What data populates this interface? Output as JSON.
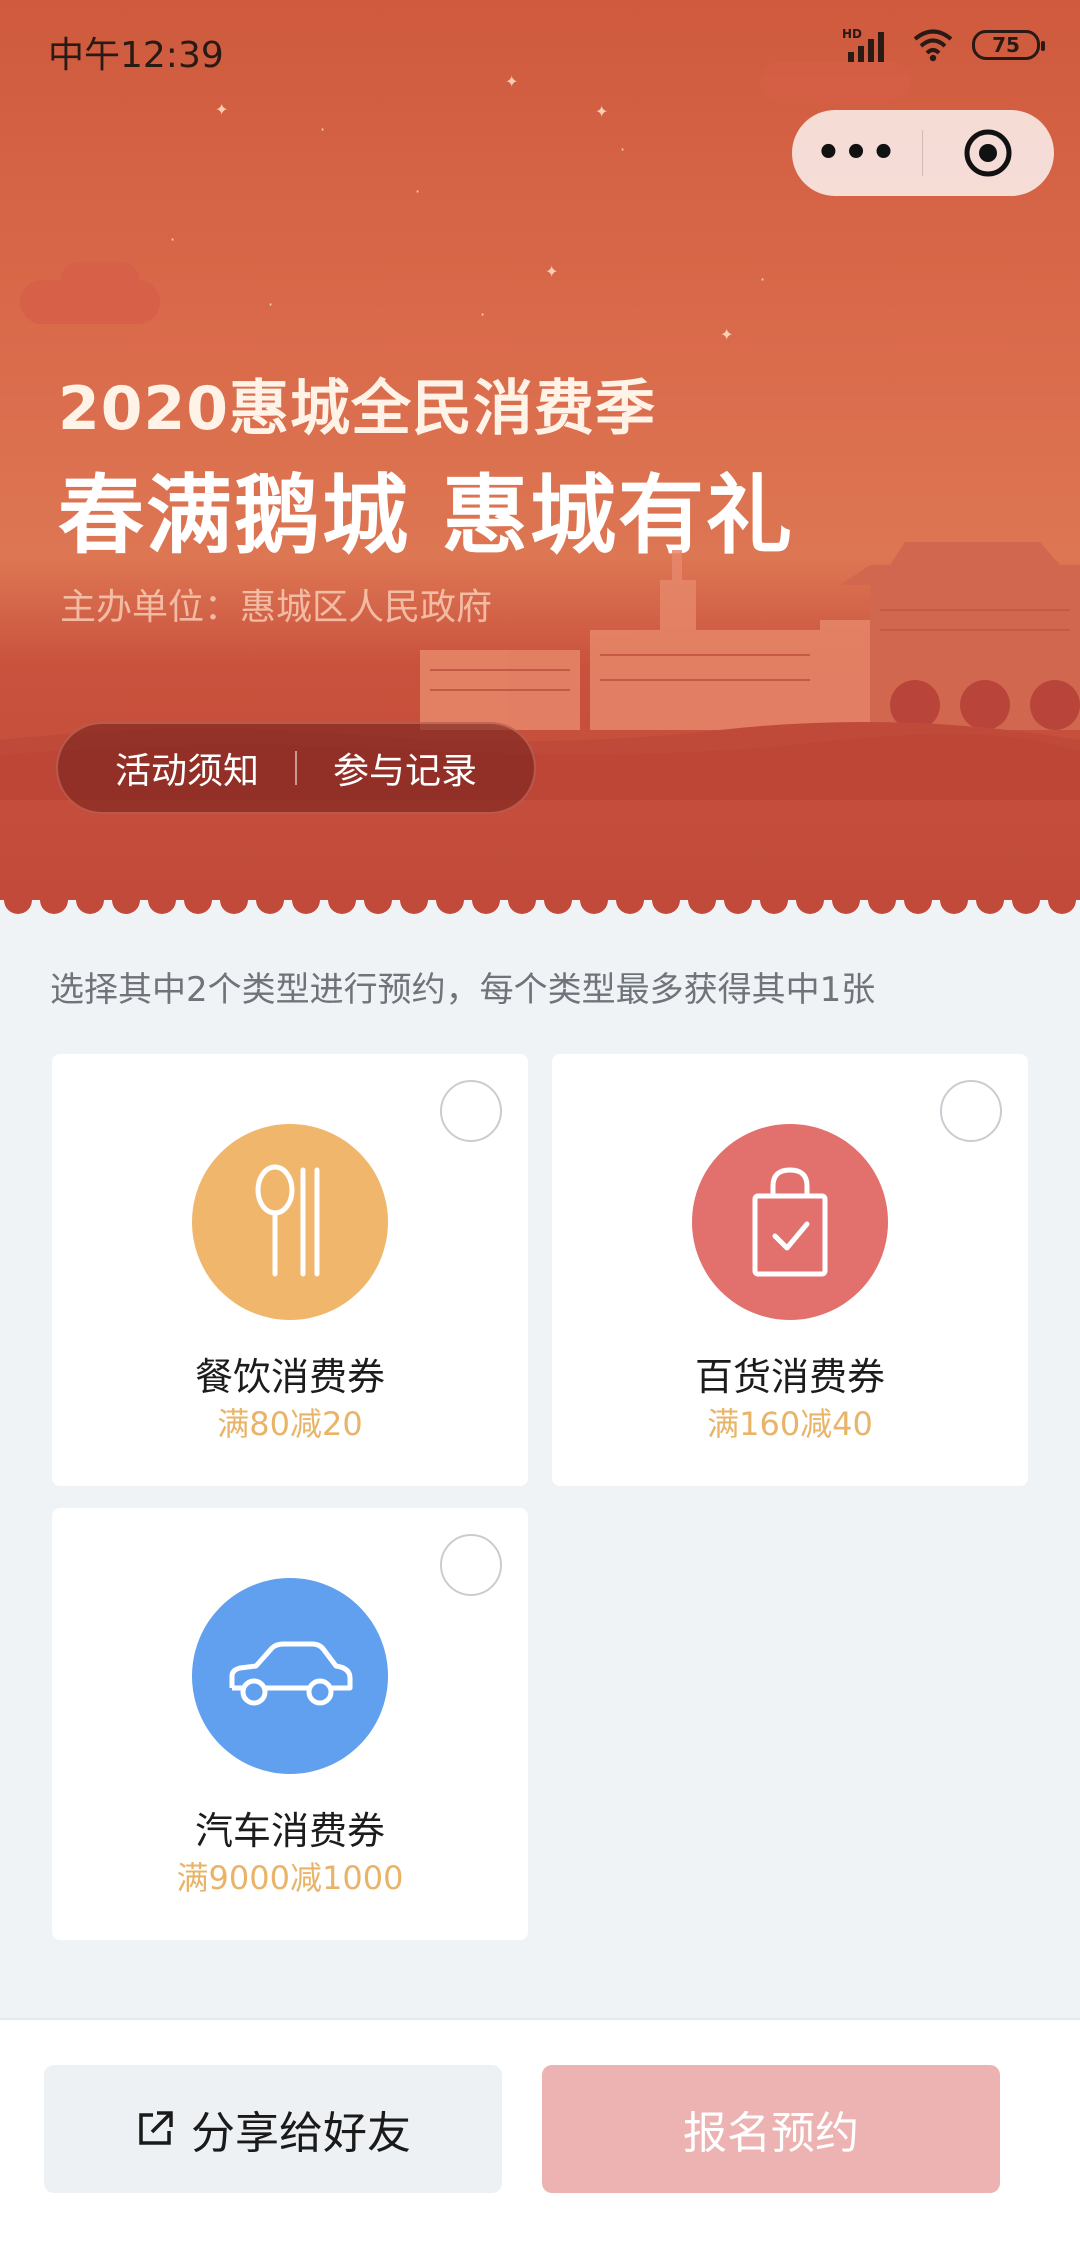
{
  "status_bar": {
    "time": "中午12:39",
    "signal_tag": "HD",
    "battery": "75"
  },
  "capsule": {
    "more_label": "•••"
  },
  "hero": {
    "title_line1": "2020惠城全民消费季",
    "title_line2": "春满鹅城  惠城有礼",
    "organizer": "主办单位：惠城区人民政府",
    "tab_notice": "活动须知",
    "tab_records": "参与记录"
  },
  "main": {
    "hint": "选择其中2个类型进行预约，每个类型最多获得其中1张",
    "coupons": [
      {
        "name": "餐饮消费券",
        "rule": "满80减20",
        "icon": "spoon-chopsticks-icon",
        "color": "#f0b66c"
      },
      {
        "name": "百货消费券",
        "rule": "满160减40",
        "icon": "shopping-bag-icon",
        "color": "#e2706d"
      },
      {
        "name": "汽车消费券",
        "rule": "满9000减1000",
        "icon": "car-icon",
        "color": "#60a0ee"
      }
    ]
  },
  "bottom_bar": {
    "share_label": "分享给好友",
    "book_label": "报名预约"
  },
  "colors": {
    "accent": "#d9694a",
    "rule_text": "#e9b468",
    "book_disabled": "#ecb3b2"
  }
}
